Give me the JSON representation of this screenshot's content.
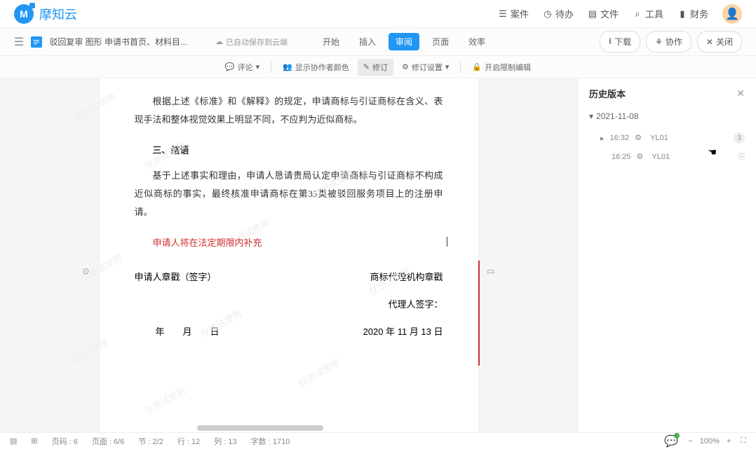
{
  "app": {
    "name": "摩知云"
  },
  "nav": {
    "items": [
      {
        "label": "案件",
        "icon": "case"
      },
      {
        "label": "待办",
        "icon": "todo"
      },
      {
        "label": "文件",
        "icon": "file"
      },
      {
        "label": "工具",
        "icon": "tool"
      },
      {
        "label": "财务",
        "icon": "finance"
      }
    ]
  },
  "doc": {
    "title": "驳回复审 图形 申请书首页、材料目...",
    "save_status": "已自动保存到云端",
    "tabs": [
      {
        "label": "开始"
      },
      {
        "label": "插入"
      },
      {
        "label": "审阅",
        "active": true
      },
      {
        "label": "页面"
      },
      {
        "label": "效率"
      }
    ],
    "actions": {
      "download": "下载",
      "collab": "协作",
      "close": "关闭"
    }
  },
  "subtoolbar": {
    "comment": "评论",
    "showcolor": "显示协作者颜色",
    "revision": "修订",
    "revsettings": "修订设置",
    "restrict": "开启限制编辑"
  },
  "content": {
    "watermark": "仅测试使用",
    "para1": "根据上述《标准》和《解释》的规定，申请商标与引证商标在含义、表现手法和整体视觉效果上明显不同，不应判为近似商标。",
    "heading": "三、结语",
    "para2": "基于上述事实和理由，申请人恳请贵局认定申请商标与引证商标不构成近似商标的事实，最终核准申请商标在第35类被驳回服务项目上的注册申请。",
    "red": "申请人将在法定期限内补充",
    "sig": {
      "left1": "申请人章戳（签字）",
      "right1": "商标代理机构章戳",
      "right2": "代理人签字：",
      "left3": "年　　月　　日",
      "right3": "2020 年 11 月 13 日"
    }
  },
  "history": {
    "title": "历史版本",
    "date": "2021-11-08",
    "versions": [
      {
        "time": "16:32",
        "user": "YL01",
        "count": "3"
      },
      {
        "time": "16:25",
        "user": "YL01"
      }
    ]
  },
  "status": {
    "page_no": "页码 : 6",
    "page": "页面 : 6/6",
    "section": "节 : 2/2",
    "row": "行 : 12",
    "col": "列 : 13",
    "words": "字数 : 1710",
    "zoom": "100%"
  }
}
